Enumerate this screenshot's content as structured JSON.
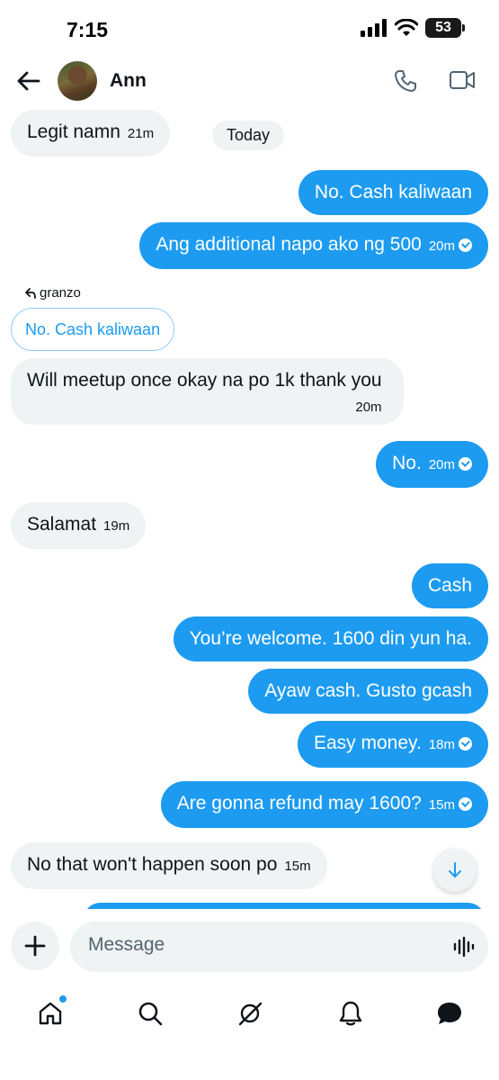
{
  "status_bar": {
    "time": "7:15",
    "battery": "53"
  },
  "header": {
    "contact_name": "Ann"
  },
  "messages": {
    "m1": {
      "text": "Legit namn",
      "time": "21m"
    },
    "today": "Today",
    "m2": {
      "text": "No. Cash kaliwaan"
    },
    "m3": {
      "text": "Ang additional napo ako ng 500",
      "time": "20m"
    },
    "reply_label": "granzo",
    "quoted": "No. Cash kaliwaan",
    "m4": {
      "text": "Will meetup once okay na po 1k thank you",
      "time": "20m"
    },
    "m5": {
      "text": "No.",
      "time": "20m"
    },
    "m6": {
      "text": "Salamat",
      "time": "19m"
    },
    "m7": {
      "text": "Cash"
    },
    "m8": {
      "text": "You’re welcome. 1600 din yun ha."
    },
    "m9": {
      "text": "Ayaw cash. Gusto gcash"
    },
    "m10": {
      "text": "Easy money.",
      "time": "18m"
    },
    "m11": {
      "text": "Are gonna refund may 1600?",
      "time": "15m"
    },
    "m12": {
      "text": "No that won't happen soon po",
      "time": "15m"
    }
  },
  "composer": {
    "placeholder": "Message"
  },
  "colors": {
    "accent": "#1d9bf0",
    "incoming": "#eff3f4"
  },
  "icons": [
    "back-arrow-icon",
    "phone-icon",
    "video-icon",
    "plus-icon",
    "voice-icon",
    "home-icon",
    "search-icon",
    "grok-icon",
    "bell-icon",
    "messages-icon",
    "chevron-down-icon",
    "reply-arrow-icon"
  ]
}
